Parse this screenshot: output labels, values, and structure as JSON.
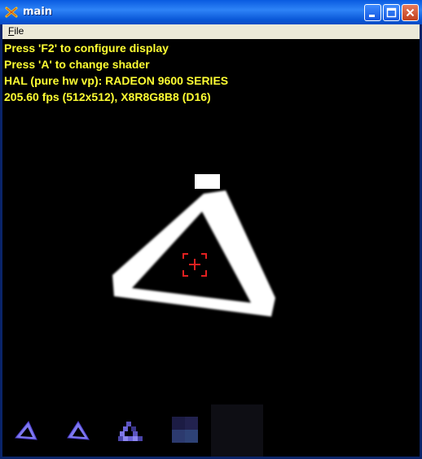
{
  "window": {
    "title": "main",
    "title_color": "#FFFFFF",
    "titlebar_color": "#0A5BE0"
  },
  "menubar": {
    "items": [
      {
        "label": "File",
        "mnemonic": "F",
        "rest": "ile"
      }
    ]
  },
  "hud": {
    "color": "#FFFF33",
    "lines": [
      "Press 'F2' to configure display",
      "Press 'A' to change shader",
      "HAL (pure hw vp): RADEON 9600 SERIES",
      "205.60 fps (512x512), X8R8G8B8 (D16)"
    ]
  },
  "scene": {
    "background": "#000000",
    "shape": "white-brush-triangle",
    "crosshair_color": "#E02020"
  },
  "thumbnails": [
    {
      "name": "thumb-triangle-1",
      "style": "blue-purple-triangle"
    },
    {
      "name": "thumb-triangle-2",
      "style": "blue-purple-triangle"
    },
    {
      "name": "thumb-triangle-3",
      "style": "pixelated-triangle"
    },
    {
      "name": "thumb-block-4",
      "style": "dark-blue-blocks"
    },
    {
      "name": "thumb-block-5",
      "style": "dark-square"
    }
  ]
}
